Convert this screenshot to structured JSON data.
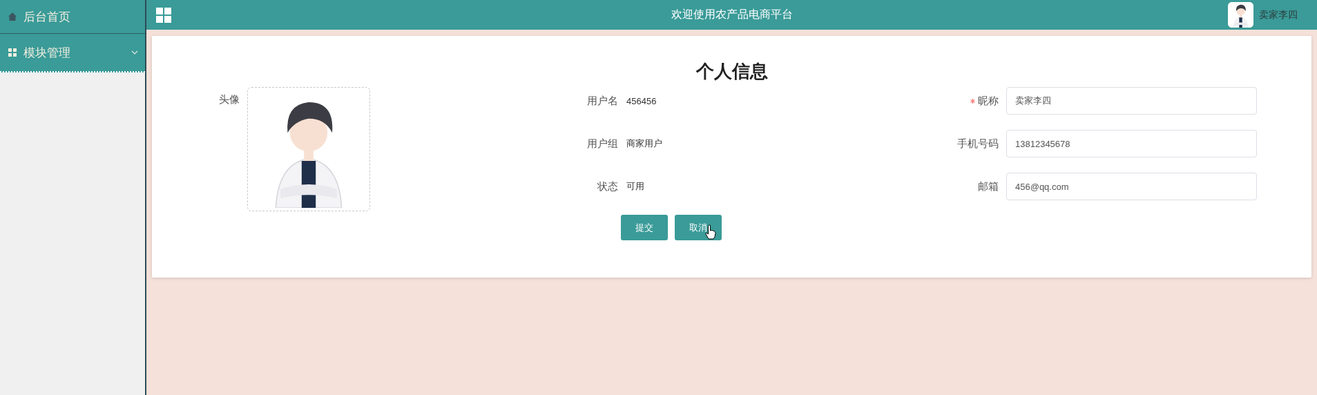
{
  "sidebar": {
    "items": [
      {
        "label": "后台首页",
        "kind": "home"
      },
      {
        "label": "模块管理",
        "kind": "submenu"
      }
    ]
  },
  "top_bar": {
    "title": "欢迎使用农产品电商平台",
    "user_name": "卖家李四"
  },
  "profile": {
    "title": "个人信息",
    "avatar_label": "头像",
    "info": [
      {
        "label": "用户名",
        "value": "456456"
      },
      {
        "label": "用户组",
        "value": "商家用户"
      },
      {
        "label": "状态",
        "value": "可用"
      }
    ],
    "fields": [
      {
        "label": "昵称",
        "required": true,
        "value": "卖家李四"
      },
      {
        "label": "手机号码",
        "required": false,
        "value": "13812345678"
      },
      {
        "label": "邮箱",
        "required": false,
        "value": "456@qq.com"
      }
    ],
    "buttons": [
      {
        "label": "提交"
      },
      {
        "label": "取消"
      }
    ]
  }
}
